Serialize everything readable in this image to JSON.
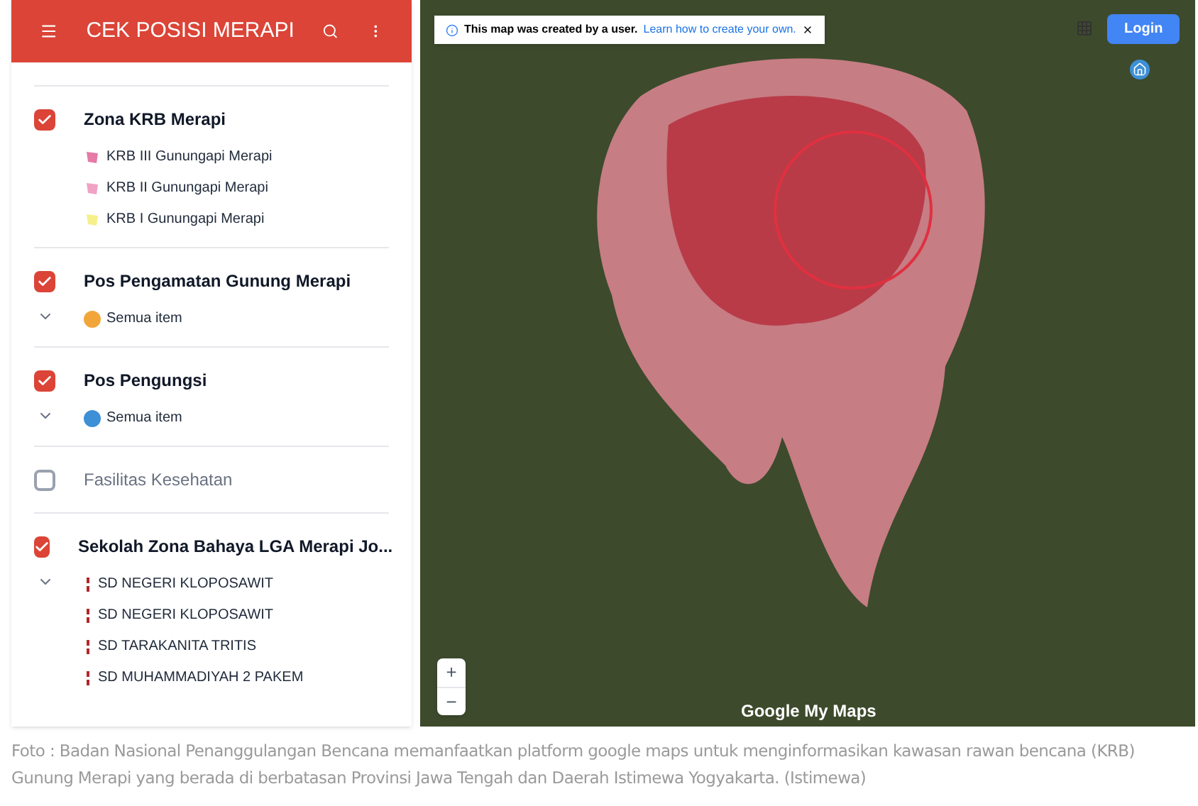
{
  "app_bar": {
    "title": "CEK POSISI MERAPI"
  },
  "layers": [
    {
      "name": "Zona KRB Merapi",
      "checked": true,
      "items": [
        {
          "label": "KRB III Gunungapi Merapi",
          "kind": "polygon",
          "color": "#e57ba6"
        },
        {
          "label": "KRB II Gunungapi Merapi",
          "kind": "polygon",
          "color": "#f0a3c4"
        },
        {
          "label": "KRB I Gunungapi Merapi",
          "kind": "polygon",
          "color": "#f5f08a"
        }
      ]
    },
    {
      "name": "Pos Pengamatan Gunung Merapi",
      "checked": true,
      "collapsible": true,
      "items": [
        {
          "label": "Semua item",
          "kind": "marker",
          "color": "#f2a63a"
        }
      ]
    },
    {
      "name": "Pos Pengungsi",
      "checked": true,
      "collapsible": true,
      "items": [
        {
          "label": "Semua item",
          "kind": "marker",
          "color": "#3d8fd6"
        }
      ]
    },
    {
      "name": "Fasilitas Kesehatan",
      "checked": false
    },
    {
      "name": "Sekolah Zona Bahaya LGA Merapi Jo...",
      "checked": true,
      "collapsible": true,
      "items": [
        {
          "label": "SD NEGERI KLOPOSAWIT",
          "kind": "pin",
          "color": "#b3262b"
        },
        {
          "label": "SD NEGERI KLOPOSAWIT",
          "kind": "pin",
          "color": "#b3262b"
        },
        {
          "label": "SD TARAKANITA TRITIS",
          "kind": "pin",
          "color": "#b3262b"
        },
        {
          "label": "SD MUHAMMADIYAH 2 PAKEM",
          "kind": "pin",
          "color": "#b3262b"
        }
      ]
    }
  ],
  "map": {
    "notice": "This map was created by a user.",
    "notice_link": "Learn how to create your own.",
    "login": "Login",
    "zoom_in": "+",
    "zoom_out": "−",
    "logo": "Google My Maps"
  },
  "caption": "Foto : Badan Nasional Penanggulangan Bencana memanfaatkan platform google maps untuk menginformasikan kawasan rawan bencana (KRB) Gunung Merapi yang berada di berbatasan Provinsi Jawa Tengah dan Daerah Istimewa Yogyakarta. (Istimewa)"
}
